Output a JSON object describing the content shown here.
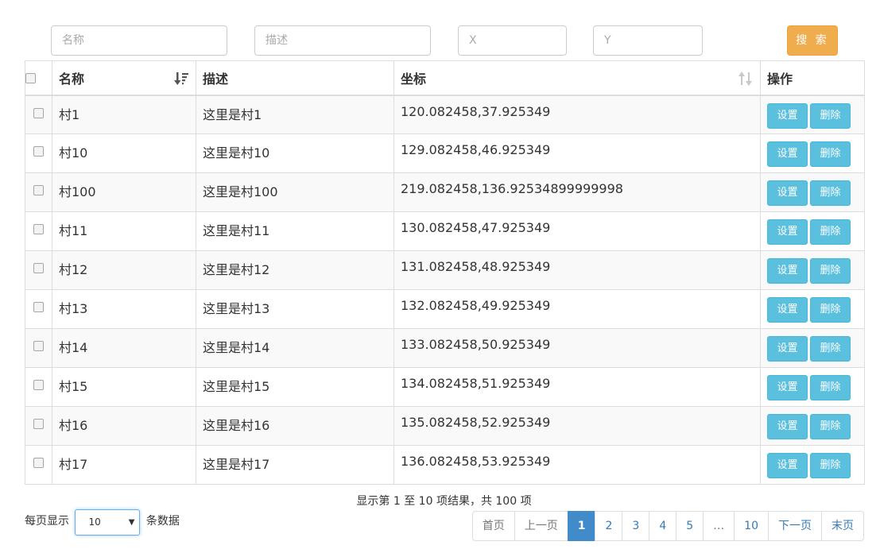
{
  "search": {
    "name_placeholder": "名称",
    "desc_placeholder": "描述",
    "x_placeholder": "X",
    "y_placeholder": "Y",
    "button_label": "搜 索"
  },
  "table": {
    "headers": {
      "name": "名称",
      "desc": "描述",
      "coord": "坐标",
      "ops": "操作"
    },
    "rows": [
      {
        "name": "村1",
        "desc": "这里是村1",
        "coord": "120.082458,37.925349"
      },
      {
        "name": "村10",
        "desc": "这里是村10",
        "coord": "129.082458,46.925349"
      },
      {
        "name": "村100",
        "desc": "这里是村100",
        "coord": "219.082458,136.92534899999998"
      },
      {
        "name": "村11",
        "desc": "这里是村11",
        "coord": "130.082458,47.925349"
      },
      {
        "name": "村12",
        "desc": "这里是村12",
        "coord": "131.082458,48.925349"
      },
      {
        "name": "村13",
        "desc": "这里是村13",
        "coord": "132.082458,49.925349"
      },
      {
        "name": "村14",
        "desc": "这里是村14",
        "coord": "133.082458,50.925349"
      },
      {
        "name": "村15",
        "desc": "这里是村15",
        "coord": "134.082458,51.925349"
      },
      {
        "name": "村16",
        "desc": "这里是村16",
        "coord": "135.082458,52.925349"
      },
      {
        "name": "村17",
        "desc": "这里是村17",
        "coord": "136.082458,53.925349"
      }
    ],
    "set_label": "设置",
    "delete_label": "删除"
  },
  "footer": {
    "summary": "显示第 1 至 10 项结果，共 100 项",
    "perpage_label": "每页显示",
    "perpage_value": "10",
    "perpage_suffix": "条数据",
    "pages": [
      {
        "label": "首页",
        "state": "disabled",
        "name": "first-page-link"
      },
      {
        "label": "上一页",
        "state": "disabled",
        "name": "prev-page-link"
      },
      {
        "label": "1",
        "state": "active",
        "name": "page-link"
      },
      {
        "label": "2",
        "state": "",
        "name": "page-link"
      },
      {
        "label": "3",
        "state": "",
        "name": "page-link"
      },
      {
        "label": "4",
        "state": "",
        "name": "page-link"
      },
      {
        "label": "5",
        "state": "",
        "name": "page-link"
      },
      {
        "label": "…",
        "state": "disabled",
        "name": "page-ellipsis"
      },
      {
        "label": "10",
        "state": "",
        "name": "page-link"
      },
      {
        "label": "下一页",
        "state": "",
        "name": "next-page-link"
      },
      {
        "label": "末页",
        "state": "",
        "name": "last-page-link"
      }
    ]
  },
  "colors": {
    "search_button": "#f0ad4e",
    "action_button": "#5bc0de",
    "active_page": "#428bca"
  }
}
